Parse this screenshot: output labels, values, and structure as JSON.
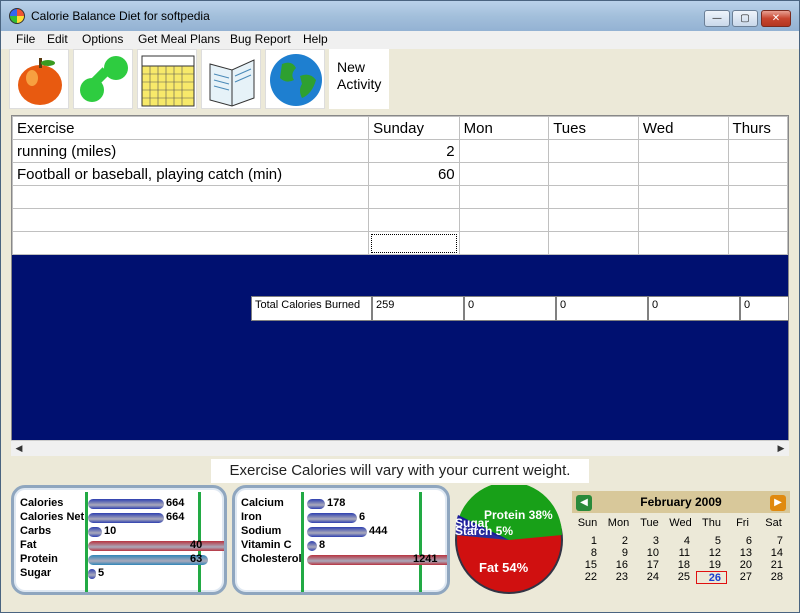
{
  "window": {
    "title": "Calorie Balance Diet for softpedia"
  },
  "menu": [
    "File",
    "Edit",
    "Options",
    "Get Meal Plans",
    "Bug Report",
    "Help"
  ],
  "toolbar": {
    "buttons": [
      {
        "icon": "apple-icon"
      },
      {
        "icon": "dumbbell-icon"
      },
      {
        "icon": "calendar-icon"
      },
      {
        "icon": "book-icon"
      },
      {
        "icon": "globe-icon"
      }
    ],
    "new_activity_line1": "New",
    "new_activity_line2": "Activity"
  },
  "grid": {
    "headers": [
      "Exercise",
      "Sunday",
      "Mon",
      "Tues",
      "Wed",
      "Thurs"
    ],
    "rows": [
      [
        "running (miles)",
        "2",
        "",
        "",
        "",
        ""
      ],
      [
        "Football or baseball, playing catch (min)",
        "60",
        "",
        "",
        "",
        ""
      ],
      [
        "",
        "",
        "",
        "",
        "",
        ""
      ],
      [
        "",
        "",
        "",
        "",
        "",
        ""
      ],
      [
        "",
        "",
        "",
        "",
        "",
        ""
      ]
    ],
    "totals_label": "Total Calories Burned",
    "totals": [
      "259",
      "0",
      "0",
      "0",
      "0"
    ]
  },
  "note": "Exercise Calories will vary with your current weight.",
  "nutrients_left": [
    {
      "label": "Calories",
      "value": "664",
      "color": "#2d3fb0"
    },
    {
      "label": "Calories Net",
      "value": "664",
      "color": "#2d3fb0"
    },
    {
      "label": "Carbs",
      "value": "10",
      "color": "#2d3fb0"
    },
    {
      "label": "Fat",
      "value": "40",
      "color": "#b8333f"
    },
    {
      "label": "Protein",
      "value": "63",
      "color": "#2f86b8"
    },
    {
      "label": "Sugar",
      "value": "5",
      "color": "#2d3fb0"
    }
  ],
  "nutrients_mid": [
    {
      "label": "Calcium",
      "value": "178",
      "color": "#2d3fb0"
    },
    {
      "label": "Iron",
      "value": "6",
      "color": "#2d3fb0"
    },
    {
      "label": "Sodium",
      "value": "444",
      "color": "#2d3fb0"
    },
    {
      "label": "Vitamin C",
      "value": "8",
      "color": "#2d3fb0"
    },
    {
      "label": "Cholesterol",
      "value": "1241",
      "color": "#b8333f"
    }
  ],
  "pie": {
    "protein_label": "Protein 38%",
    "sugar_label": "Sugar",
    "starch_label": "Starch 5%",
    "fat_label": "Fat 54%",
    "colors": {
      "protein": "#18a018",
      "fat": "#d01010",
      "sugar": "#1a1a9a"
    }
  },
  "calendar": {
    "title": "February 2009",
    "days_of_week": [
      "Sun",
      "Mon",
      "Tue",
      "Wed",
      "Thu",
      "Fri",
      "Sat"
    ],
    "weeks": [
      [
        "1",
        "2",
        "3",
        "4",
        "5",
        "6",
        "7"
      ],
      [
        "8",
        "9",
        "10",
        "11",
        "12",
        "13",
        "14"
      ],
      [
        "15",
        "16",
        "17",
        "18",
        "19",
        "20",
        "21"
      ],
      [
        "22",
        "23",
        "24",
        "25",
        "26",
        "27",
        "28"
      ]
    ],
    "today": "26"
  }
}
